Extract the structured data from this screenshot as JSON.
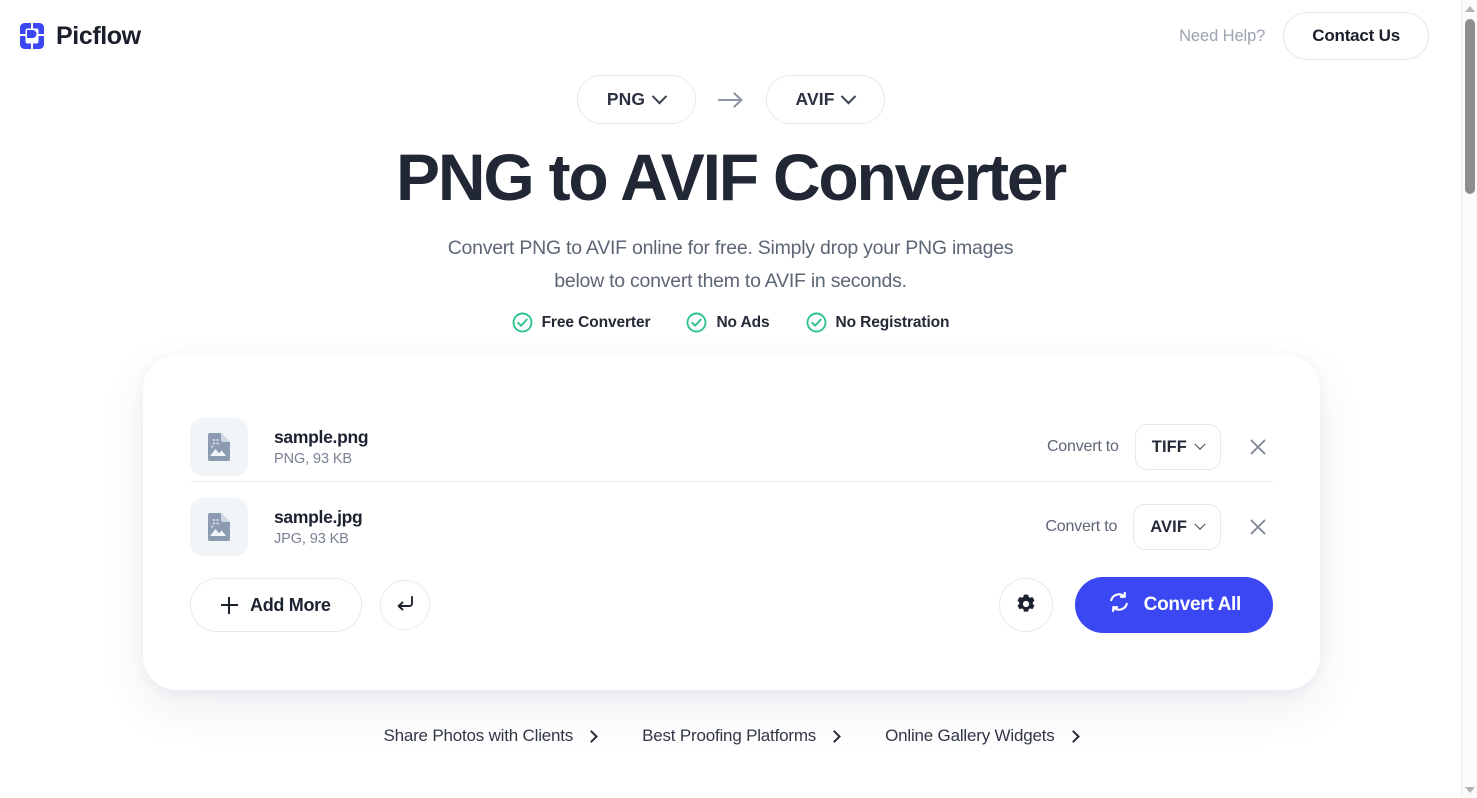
{
  "header": {
    "brand_name": "Picflow",
    "need_help": "Need Help?",
    "contact_label": "Contact Us"
  },
  "format_row": {
    "source_format": "PNG",
    "target_format": "AVIF",
    "arrow": "→"
  },
  "hero": {
    "title": "PNG to AVIF Converter",
    "subtitle": "Convert PNG to AVIF online for free. Simply drop your PNG images below to convert them to AVIF in seconds.",
    "badges": [
      {
        "label": "Free Converter",
        "icon": "check-circle-icon"
      },
      {
        "label": "No Ads",
        "icon": "check-circle-icon"
      },
      {
        "label": "No Registration",
        "icon": "check-circle-icon"
      }
    ]
  },
  "card": {
    "convert_to_label": "Convert to",
    "files": [
      {
        "name": "sample.png",
        "meta": "PNG, 93 KB",
        "target_format": "TIFF",
        "icon": "image-file-icon",
        "remove_icon": "close-icon"
      },
      {
        "name": "sample.jpg",
        "meta": "JPG, 93 KB",
        "target_format": "AVIF",
        "icon": "image-file-icon",
        "remove_icon": "close-icon"
      }
    ],
    "actions": {
      "add_more_label": "Add More",
      "reset_icon": "return-arrow-icon",
      "settings_icon": "gear-icon",
      "convert_all_label": "Convert All",
      "convert_all_icon": "refresh-icon"
    }
  },
  "footer": {
    "links": [
      {
        "label": "Share Photos with Clients"
      },
      {
        "label": "Best Proofing Platforms"
      },
      {
        "label": "Online Gallery Widgets"
      }
    ]
  },
  "colors": {
    "accent": "#3b47f2",
    "text_dark": "#1d2230",
    "text_muted": "#7a8292",
    "check_green": "#2fc38a",
    "card_bg": "#ffffff"
  }
}
